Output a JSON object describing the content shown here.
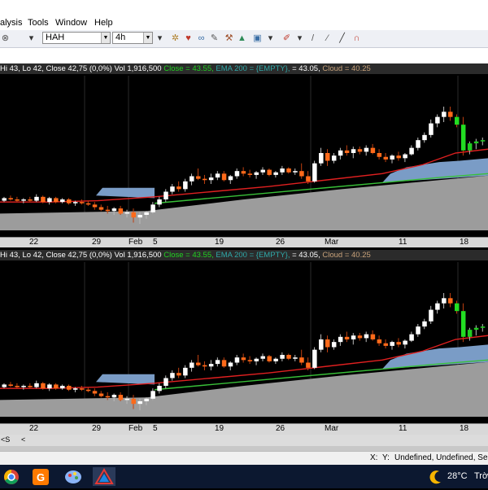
{
  "menu": {
    "items": [
      "alysis",
      "Tools",
      "Window",
      "Help"
    ]
  },
  "toolbar": {
    "symbol": "HAH",
    "interval": "4h"
  },
  "info_line": {
    "prefix": "Hi 43, Lo 42, Close 42,75 (0,0%) Vol 1,916,500",
    "close": "Close = 43.55,",
    "ema": "EMA 200 = {EMPTY},",
    "mid": "= 43.05,",
    "cloud": "Cloud = 40.25"
  },
  "date_axis": [
    "22",
    "29",
    "Feb",
    "5",
    "19",
    "26",
    "Mar",
    "11",
    "18"
  ],
  "nav": {
    "left": "<S",
    "mid": "<"
  },
  "status": {
    "x": "X:",
    "y": "Y:",
    "text": "Undefined, Undefined, Servi"
  },
  "tray": {
    "temp": "28°C",
    "label": "Trời"
  },
  "chart_data": {
    "type": "candlestick",
    "y_min": 36,
    "y_max": 48,
    "candles": [
      [
        38.3,
        38.6,
        38.2,
        38.5
      ],
      [
        38.5,
        38.7,
        38.3,
        38.4
      ],
      [
        38.4,
        38.6,
        38.2,
        38.3
      ],
      [
        38.3,
        38.5,
        38.1,
        38.4
      ],
      [
        38.4,
        38.6,
        38.2,
        38.3
      ],
      [
        38.3,
        38.8,
        38.2,
        38.6
      ],
      [
        38.6,
        38.7,
        38.1,
        38.2
      ],
      [
        38.2,
        38.6,
        38.0,
        38.5
      ],
      [
        38.5,
        38.6,
        38.1,
        38.2
      ],
      [
        38.2,
        38.5,
        38.1,
        38.4
      ],
      [
        38.4,
        38.5,
        38.0,
        38.1
      ],
      [
        38.1,
        38.3,
        37.9,
        38.2
      ],
      [
        38.2,
        38.4,
        38.0,
        38.1
      ],
      [
        38.1,
        38.3,
        37.9,
        38.0
      ],
      [
        38.0,
        38.2,
        37.6,
        37.8
      ],
      [
        37.8,
        38.0,
        37.5,
        37.6
      ],
      [
        37.6,
        37.9,
        37.3,
        37.5
      ],
      [
        37.5,
        37.8,
        37.2,
        37.7
      ],
      [
        37.7,
        37.9,
        37.2,
        37.3
      ],
      [
        37.3,
        37.6,
        37.0,
        37.4
      ],
      [
        37.4,
        37.7,
        36.6,
        37.0
      ],
      [
        37.0,
        37.4,
        36.5,
        37.2
      ],
      [
        37.2,
        37.5,
        36.9,
        37.4
      ],
      [
        37.4,
        38.2,
        37.3,
        38.0
      ],
      [
        38.0,
        38.6,
        37.8,
        38.4
      ],
      [
        38.4,
        39.2,
        38.2,
        39.0
      ],
      [
        39.0,
        39.6,
        38.8,
        39.4
      ],
      [
        39.4,
        39.8,
        39.0,
        39.2
      ],
      [
        39.2,
        40.0,
        39.0,
        39.8
      ],
      [
        39.8,
        40.4,
        39.5,
        40.2
      ],
      [
        40.2,
        40.8,
        39.9,
        40.0
      ],
      [
        40.0,
        40.3,
        39.6,
        39.9
      ],
      [
        39.9,
        40.4,
        39.6,
        40.1
      ],
      [
        40.1,
        40.6,
        39.9,
        40.4
      ],
      [
        40.4,
        40.6,
        39.8,
        39.9
      ],
      [
        39.9,
        40.3,
        39.6,
        40.2
      ],
      [
        40.2,
        40.8,
        40.0,
        40.6
      ],
      [
        40.6,
        40.9,
        40.2,
        40.4
      ],
      [
        40.4,
        40.7,
        40.1,
        40.3
      ],
      [
        40.3,
        40.6,
        40.0,
        40.5
      ],
      [
        40.5,
        40.9,
        40.3,
        40.7
      ],
      [
        40.7,
        40.8,
        40.2,
        40.3
      ],
      [
        40.3,
        40.6,
        40.1,
        40.5
      ],
      [
        40.5,
        41.0,
        40.3,
        40.8
      ],
      [
        40.8,
        40.9,
        40.4,
        40.5
      ],
      [
        40.5,
        40.8,
        40.3,
        40.6
      ],
      [
        40.6,
        41.2,
        40.0,
        40.2
      ],
      [
        40.2,
        40.6,
        39.6,
        39.8
      ],
      [
        39.8,
        41.4,
        39.7,
        41.2
      ],
      [
        41.2,
        42.4,
        41.0,
        42.0
      ],
      [
        42.0,
        42.3,
        41.0,
        41.4
      ],
      [
        41.4,
        42.0,
        41.2,
        41.8
      ],
      [
        41.8,
        42.4,
        41.5,
        42.2
      ],
      [
        42.2,
        42.6,
        41.8,
        42.0
      ],
      [
        42.0,
        42.5,
        41.6,
        42.3
      ],
      [
        42.3,
        42.5,
        41.9,
        42.1
      ],
      [
        42.1,
        42.6,
        41.8,
        42.4
      ],
      [
        42.4,
        42.7,
        41.9,
        42.0
      ],
      [
        42.0,
        42.3,
        41.5,
        41.7
      ],
      [
        41.7,
        42.0,
        41.3,
        41.5
      ],
      [
        41.5,
        41.9,
        41.2,
        41.8
      ],
      [
        41.8,
        42.1,
        41.4,
        41.6
      ],
      [
        41.6,
        42.0,
        41.3,
        41.9
      ],
      [
        41.9,
        42.6,
        41.8,
        42.4
      ],
      [
        42.4,
        43.2,
        42.2,
        43.0
      ],
      [
        43.0,
        43.6,
        42.8,
        43.4
      ],
      [
        43.4,
        44.6,
        43.2,
        44.3
      ],
      [
        44.3,
        45.0,
        44.0,
        44.8
      ],
      [
        44.8,
        45.6,
        44.4,
        45.2
      ],
      [
        45.2,
        45.6,
        44.5,
        44.8
      ],
      [
        44.8,
        45.0,
        44.0,
        44.2
      ],
      [
        44.2,
        44.8,
        41.8,
        42.2
      ],
      [
        42.2,
        42.9,
        41.9,
        42.75
      ],
      [
        42.75,
        43.1,
        42.3,
        42.9
      ],
      [
        42.9,
        43.2,
        42.6,
        43.0
      ]
    ]
  }
}
